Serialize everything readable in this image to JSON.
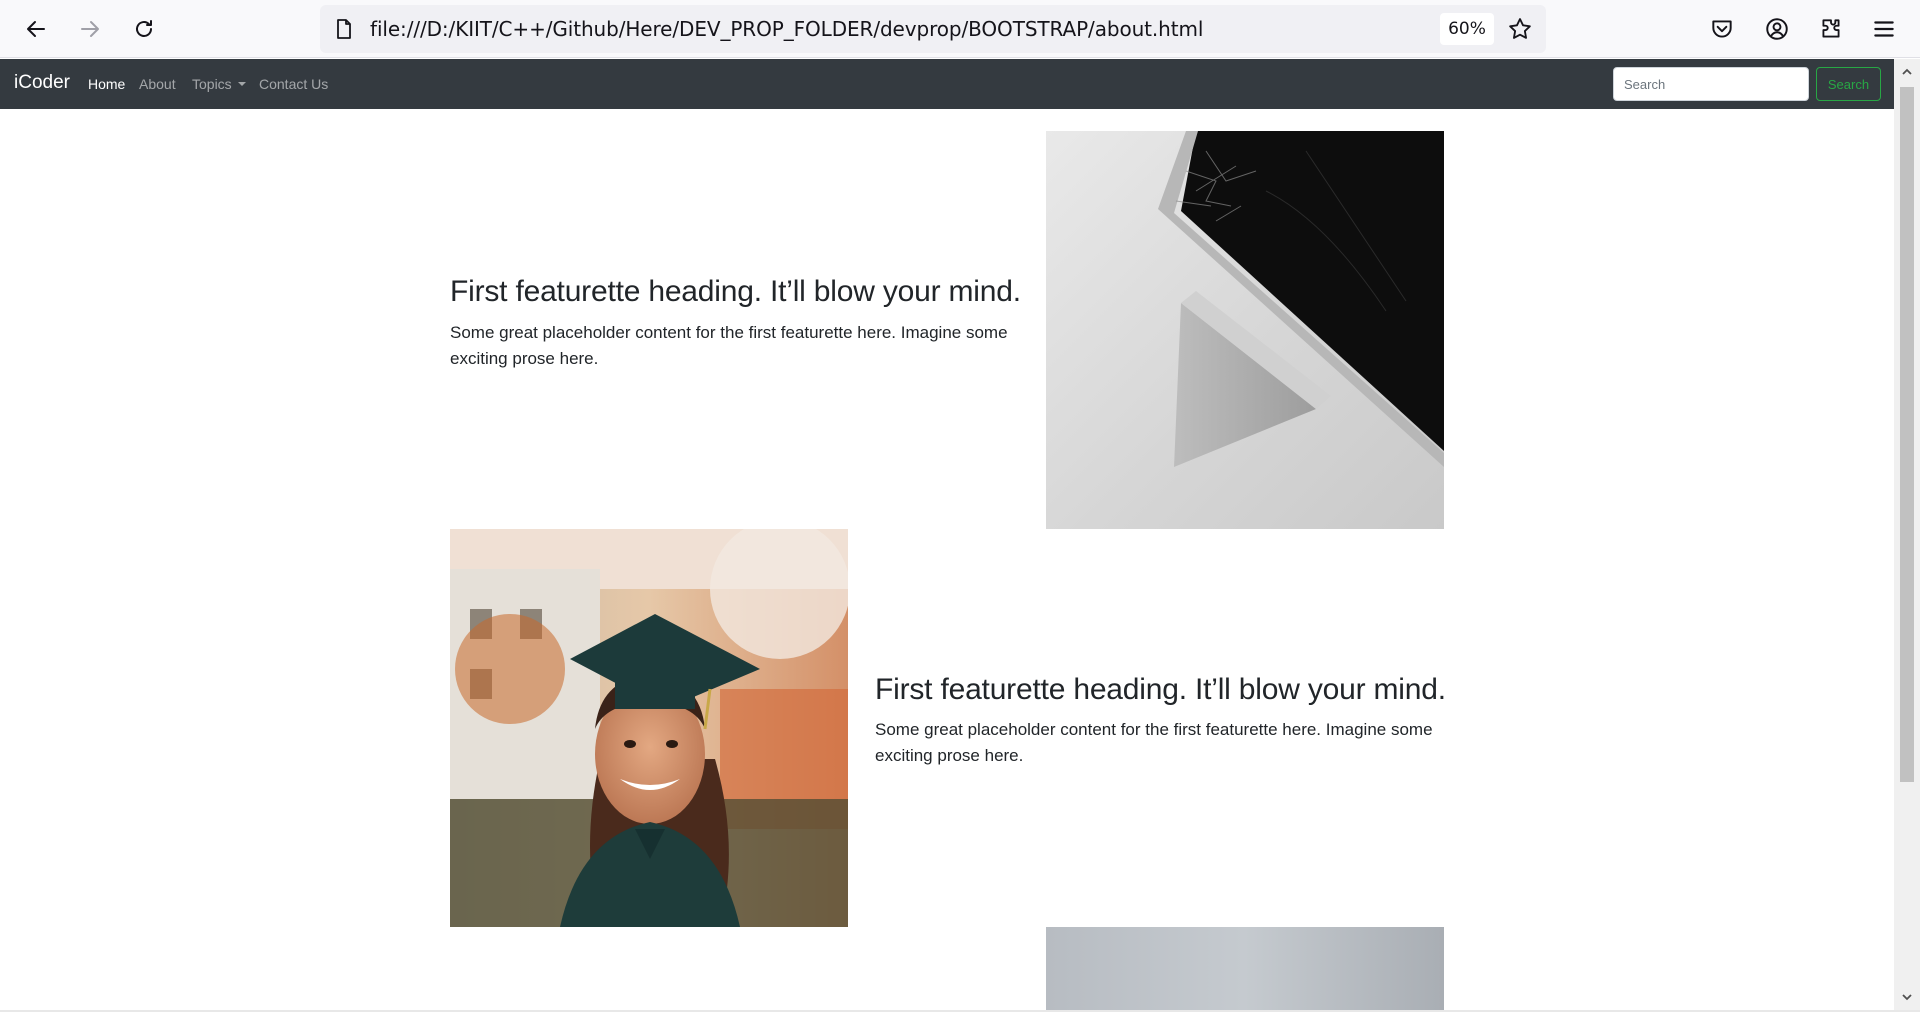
{
  "browser": {
    "url": "file:///D:/KIIT/C++/Github/Here/DEV_PROP_FOLDER/devprop/BOOTSTRAP/about.html",
    "zoom": "60%"
  },
  "site": {
    "brand": "iCoder",
    "nav": {
      "home": "Home",
      "about": "About",
      "topics": "Topics",
      "contact": "Contact Us"
    },
    "search": {
      "placeholder": "Search",
      "button": "Search"
    }
  },
  "featurettes": [
    {
      "heading": "First featurette heading. It’ll blow your mind.",
      "lead": "Some great placeholder content for the first featurette here. Imagine some exciting prose here.",
      "image": "laptop-photo"
    },
    {
      "heading": "First featurette heading. It’ll blow your mind.",
      "lead": "Some great placeholder content for the first featurette here. Imagine some exciting prose here.",
      "image": "graduate-photo"
    },
    {
      "image": "grey-photo"
    }
  ]
}
